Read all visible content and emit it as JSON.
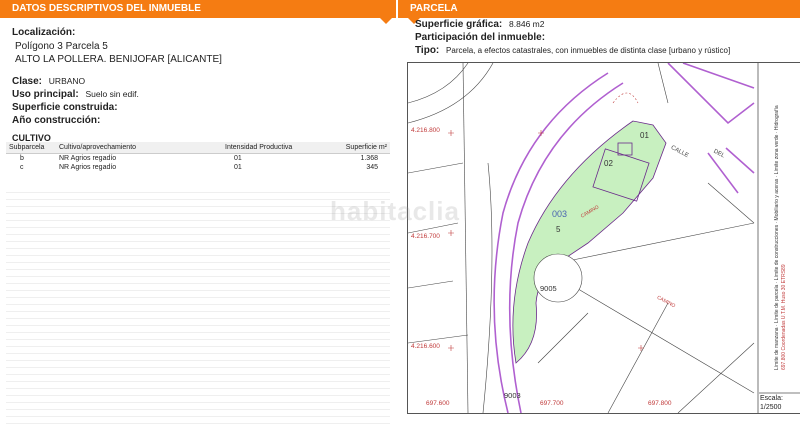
{
  "left": {
    "header": "DATOS DESCRIPTIVOS DEL INMUEBLE",
    "localizacion_label": "Localización:",
    "localizacion_line1": "Polígono 3 Parcela 5",
    "localizacion_line2": "ALTO LA POLLERA. BENIJOFAR [ALICANTE]",
    "clase_label": "Clase:",
    "clase_value": "URBANO",
    "uso_label": "Uso principal:",
    "uso_value": "Suelo sin edif.",
    "superficie_label": "Superficie construida:",
    "anio_label": "Año construcción:",
    "cultivo_title": "CULTIVO",
    "table": {
      "headers": [
        "Subparcela",
        "Cultivo/aprovechamiento",
        "Intensidad Productiva",
        "Superficie m²"
      ],
      "rows": [
        [
          "b",
          "NR Agrios regadío",
          "01",
          "1.368"
        ],
        [
          "c",
          "NR Agrios regadío",
          "01",
          "345"
        ]
      ]
    }
  },
  "right": {
    "header": "PARCELA",
    "superficie_label": "Superficie gráfica:",
    "superficie_value": "8.846 m2",
    "participacion_label": "Participación del inmueble:",
    "tipo_label": "Tipo:",
    "tipo_value": "Parcela, a efectos catastrales, con inmuebles de distinta clase [urbano y rústico]",
    "map": {
      "labels": {
        "coord_y1": "4.216.800",
        "coord_y2": "4.216.700",
        "coord_y3": "4.216.600",
        "coord_x1": "697.600",
        "coord_x2": "697.700",
        "coord_x3": "697.800",
        "parcel_003": "003",
        "parcel_5": "5",
        "parcel_9005": "9005",
        "parcel_9003": "9003",
        "sub_01": "01",
        "sub_02": "02",
        "street_calle": "CALLE",
        "street_del": "DEL",
        "camino1": "CAMINO",
        "camino2": "CAMINO"
      },
      "legend": {
        "l1": "Límite de manzana",
        "l2": "Límite de parcela",
        "l3": "Límite de construcciones",
        "l4": "Mobiliario y aceras",
        "l5": "Límite zona verde",
        "l6": "Hidrografía",
        "coords_note": "697.800 Coordenadas U.T.M. Huso 30 ETRS89"
      },
      "scale_label": "Escala:",
      "scale_value": "1/2500"
    },
    "watermark": "habitaclia"
  },
  "colors": {
    "header_orange": "#f57c12",
    "parcel_green": "#c8f0c0",
    "parcel_outline": "#6a2a8a",
    "road_purple": "#b060d0"
  }
}
